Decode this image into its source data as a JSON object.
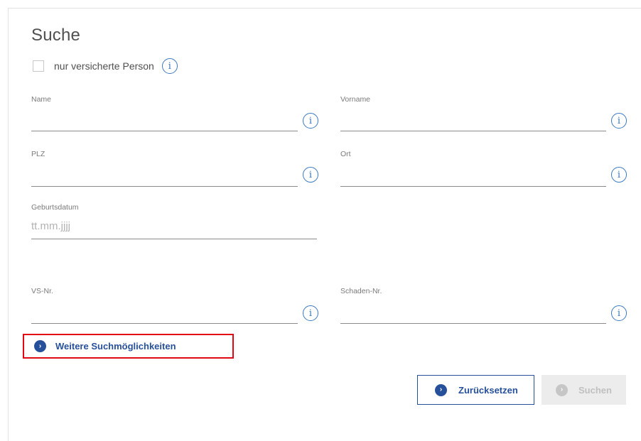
{
  "search": {
    "title": "Suche",
    "checkbox": {
      "label": "nur versicherte Person",
      "checked": false,
      "info_icon": "info-icon"
    },
    "fields": {
      "name": {
        "label": "Name",
        "value": ""
      },
      "vorname": {
        "label": "Vorname",
        "value": ""
      },
      "plz": {
        "label": "PLZ",
        "value": ""
      },
      "ort": {
        "label": "Ort",
        "value": ""
      },
      "geburtsdatum": {
        "label": "Geburtsdatum",
        "placeholder": "tt.mm.jjjj"
      },
      "vs_nr": {
        "label": "VS-Nr.",
        "value": ""
      },
      "schaden_nr": {
        "label": "Schaden-Nr.",
        "value": ""
      }
    },
    "more_options": {
      "label": "Weitere Suchmöglichkeiten",
      "icon": "chevron-right-circle-icon",
      "highlight_color": "#e30613"
    },
    "buttons": {
      "reset": {
        "label": "Zurücksetzen",
        "icon": "chevron-right-circle-icon"
      },
      "search": {
        "label": "Suchen",
        "icon": "chevron-right-circle-icon",
        "disabled": true
      }
    },
    "colors": {
      "accent": "#27509b",
      "info": "#3a78bd"
    }
  }
}
